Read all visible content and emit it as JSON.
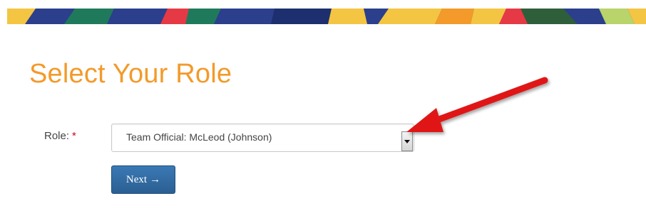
{
  "banner": {
    "colors": [
      "#2b3f8c",
      "#1f7a5c",
      "#f4c542",
      "#e63946",
      "#8fbf4a",
      "#f39a2a",
      "#2f5f3a",
      "#b8d46a"
    ]
  },
  "page": {
    "title": "Select Your Role"
  },
  "form": {
    "role_label": "Role:",
    "required_marker": "*",
    "role_selected": "Team Official: McLeod (Johnson)",
    "next_label": "Next",
    "next_arrow": "→"
  },
  "annotation": {
    "arrow_color": "#e01818"
  }
}
